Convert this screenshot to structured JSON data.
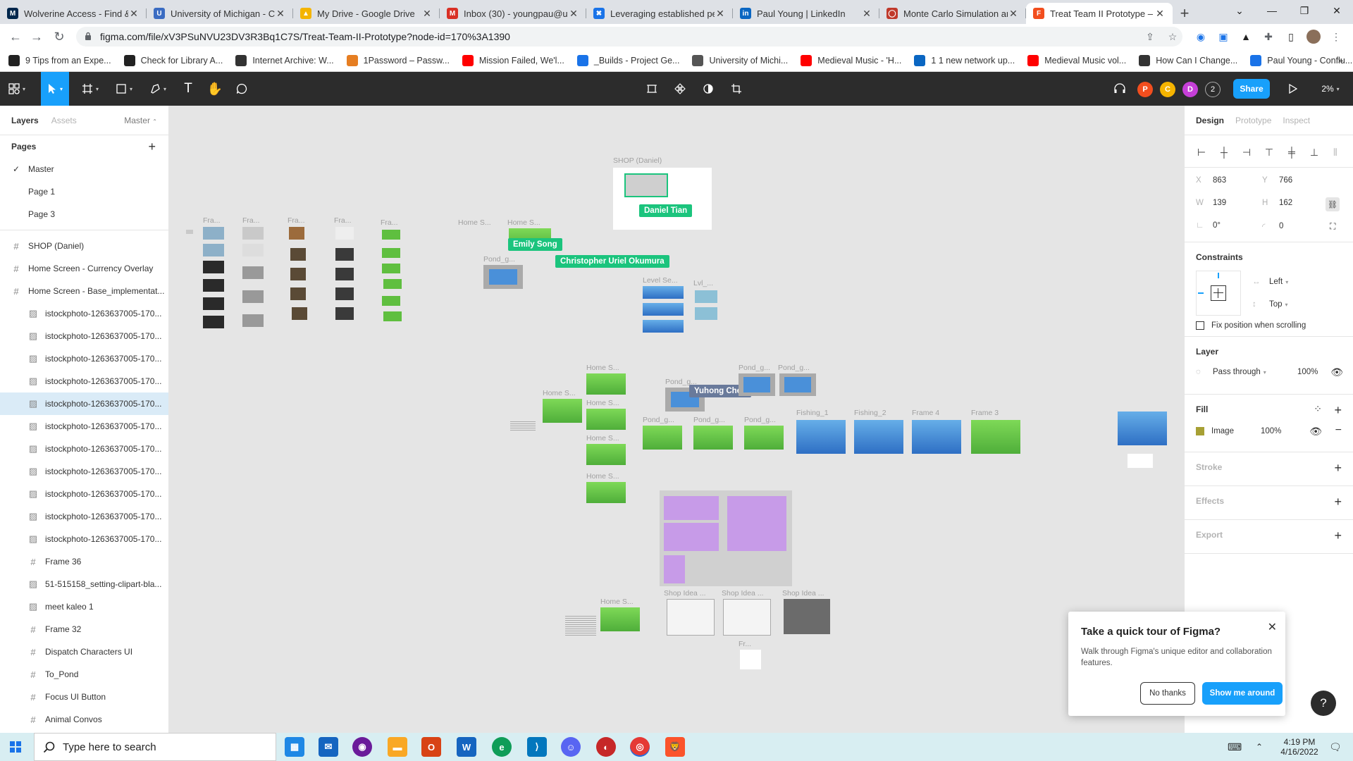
{
  "browser": {
    "tabs": [
      {
        "title": "Wolverine Access - Find &",
        "color": "#00274c",
        "glyph": "M",
        "active": false
      },
      {
        "title": "University of Michigan - C",
        "color": "#3b6cc2",
        "glyph": "U",
        "active": false
      },
      {
        "title": "My Drive - Google Drive",
        "color": "#f4b400",
        "glyph": "▲",
        "active": false
      },
      {
        "title": "Inbox (30) - youngpau@u",
        "color": "#d93025",
        "glyph": "M",
        "active": false
      },
      {
        "title": "Leveraging established pe",
        "color": "#1a73e8",
        "glyph": "✖",
        "active": false
      },
      {
        "title": "Paul Young | LinkedIn",
        "color": "#0a66c2",
        "glyph": "in",
        "active": false
      },
      {
        "title": "Monte Carlo Simulation ar",
        "color": "#c0392b",
        "glyph": "◯",
        "active": false
      },
      {
        "title": "Treat Team II Prototype – F",
        "color": "#f24e1e",
        "glyph": "F",
        "active": true
      }
    ],
    "url": "figma.com/file/xV3PSuNVU23DV3R3Bq1C7S/Treat-Team-II-Prototype?node-id=170%3A1390",
    "bookmarks": [
      {
        "label": "9 Tips from an Expe...",
        "color": "#222"
      },
      {
        "label": "Check for Library A...",
        "color": "#222"
      },
      {
        "label": "Internet Archive: W...",
        "color": "#333"
      },
      {
        "label": "1Password – Passw...",
        "color": "#e67e22"
      },
      {
        "label": "Mission Failed, We'l...",
        "color": "#ff0000"
      },
      {
        "label": "_Builds - Project Ge...",
        "color": "#1a73e8"
      },
      {
        "label": "University of Michi...",
        "color": "#555"
      },
      {
        "label": "Medieval Music - 'H...",
        "color": "#ff0000"
      },
      {
        "label": "1 1 new network up...",
        "color": "#0a66c2"
      },
      {
        "label": "Medieval Music vol...",
        "color": "#ff0000"
      },
      {
        "label": "How Can I Change...",
        "color": "#333"
      },
      {
        "label": "Paul Young - Conflu...",
        "color": "#1a73e8"
      }
    ]
  },
  "figma": {
    "toolbar": {
      "avatars": [
        {
          "letter": "P",
          "color": "#f24e1e"
        },
        {
          "letter": "C",
          "color": "#f5b400"
        },
        {
          "letter": "D",
          "color": "#c63fd8"
        }
      ],
      "avatar_count": "2",
      "share_label": "Share",
      "zoom": "2%"
    },
    "left_panel": {
      "tabs": [
        "Layers",
        "Assets"
      ],
      "page_selector": "Master",
      "pages_header": "Pages",
      "pages": [
        "Master",
        "Page 1",
        "Page 3"
      ],
      "layers": [
        {
          "name": "SHOP (Daniel)",
          "type": "frame",
          "indent": false,
          "selected": false
        },
        {
          "name": "Home Screen - Currency Overlay",
          "type": "frame",
          "indent": false,
          "selected": false
        },
        {
          "name": "Home Screen - Base_implementat...",
          "type": "frame",
          "indent": false,
          "selected": false
        },
        {
          "name": "istockphoto-1263637005-170...",
          "type": "image",
          "indent": true,
          "selected": false
        },
        {
          "name": "istockphoto-1263637005-170...",
          "type": "image",
          "indent": true,
          "selected": false
        },
        {
          "name": "istockphoto-1263637005-170...",
          "type": "image",
          "indent": true,
          "selected": false
        },
        {
          "name": "istockphoto-1263637005-170...",
          "type": "image",
          "indent": true,
          "selected": false
        },
        {
          "name": "istockphoto-1263637005-170...",
          "type": "image",
          "indent": true,
          "selected": true
        },
        {
          "name": "istockphoto-1263637005-170...",
          "type": "image",
          "indent": true,
          "selected": false
        },
        {
          "name": "istockphoto-1263637005-170...",
          "type": "image",
          "indent": true,
          "selected": false
        },
        {
          "name": "istockphoto-1263637005-170...",
          "type": "image",
          "indent": true,
          "selected": false
        },
        {
          "name": "istockphoto-1263637005-170...",
          "type": "image",
          "indent": true,
          "selected": false
        },
        {
          "name": "istockphoto-1263637005-170...",
          "type": "image",
          "indent": true,
          "selected": false
        },
        {
          "name": "istockphoto-1263637005-170...",
          "type": "image",
          "indent": true,
          "selected": false
        },
        {
          "name": "Frame 36",
          "type": "frame",
          "indent": true,
          "selected": false
        },
        {
          "name": "51-515158_setting-clipart-bla...",
          "type": "image",
          "indent": true,
          "selected": false
        },
        {
          "name": "meet kaleo 1",
          "type": "image",
          "indent": true,
          "selected": false
        },
        {
          "name": "Frame 32",
          "type": "frame",
          "indent": true,
          "selected": false
        },
        {
          "name": "Dispatch Characters UI",
          "type": "frame",
          "indent": true,
          "selected": false
        },
        {
          "name": "To_Pond",
          "type": "frame",
          "indent": true,
          "selected": false
        },
        {
          "name": "Focus UI Button",
          "type": "frame",
          "indent": true,
          "selected": false
        },
        {
          "name": "Animal Convos",
          "type": "frame",
          "indent": true,
          "selected": false
        }
      ]
    },
    "canvas": {
      "labels": {
        "shop": "SHOP (Daniel)",
        "fra": "Fra...",
        "home_s": "Home S...",
        "pond_g": "Pond_g...",
        "level_se": "Level Se...",
        "lvl": "Lvl_...",
        "fishing_1": "Fishing_1",
        "fishing_2": "Fishing_2",
        "frame_4": "Frame 4",
        "frame_3": "Frame 3",
        "shop_idea": "Shop Idea ...",
        "fr": "Fr..."
      },
      "collaborators": [
        {
          "name": "Daniel Tian",
          "color": "#1bc47d"
        },
        {
          "name": "Emily Song",
          "color": "#1bc47d"
        },
        {
          "name": "Christopher Uriel Okumura",
          "color": "#1bc47d"
        },
        {
          "name": "Yuhong Chen",
          "color": "#697a9b"
        }
      ]
    },
    "right_panel": {
      "tabs": [
        "Design",
        "Prototype",
        "Inspect"
      ],
      "x": "863",
      "y": "766",
      "w": "139",
      "h": "162",
      "rotation": "0°",
      "radius": "0",
      "constraints_title": "Constraints",
      "constraint_h": "Left",
      "constraint_v": "Top",
      "fix_position": "Fix position when scrolling",
      "layer_title": "Layer",
      "blend": "Pass through",
      "layer_opacity": "100%",
      "fill_title": "Fill",
      "fill_type": "Image",
      "fill_opacity": "100%",
      "stroke_title": "Stroke",
      "effects_title": "Effects",
      "export_title": "Export"
    },
    "tour": {
      "title": "Take a quick tour of Figma?",
      "body": "Walk through Figma's unique editor and collaboration features.",
      "no_label": "No thanks",
      "yes_label": "Show me around"
    }
  },
  "taskbar": {
    "search_placeholder": "Type here to search",
    "time": "4:19 PM",
    "date": "4/16/2022"
  }
}
